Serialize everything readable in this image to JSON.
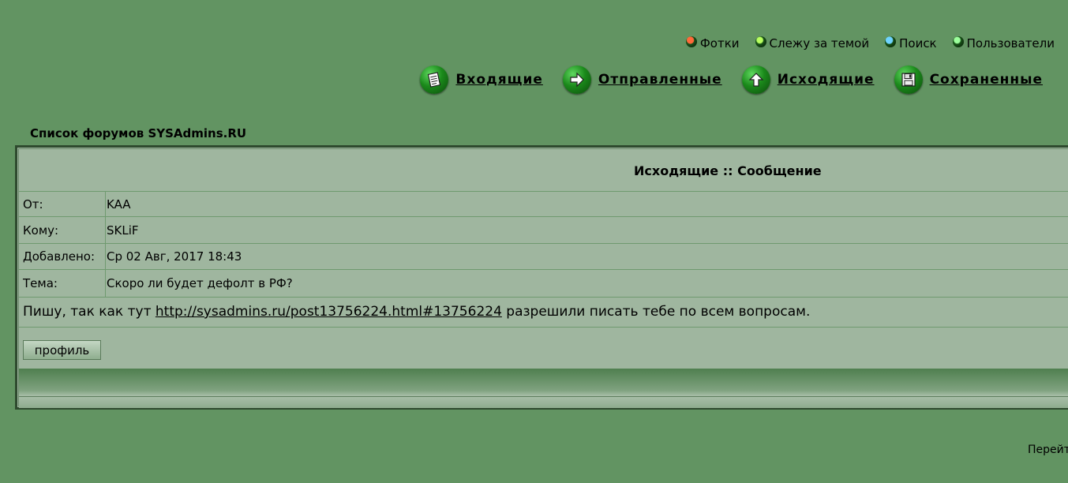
{
  "top_links": [
    {
      "label": "Фотки",
      "icon": "red-dot-icon"
    },
    {
      "label": "Слежу за темой",
      "icon": "green-dot-icon"
    },
    {
      "label": "Поиск",
      "icon": "blue-dot-icon"
    },
    {
      "label": "Пользователи",
      "icon": "list-dot-icon"
    }
  ],
  "nav": [
    {
      "label": "Входящие",
      "icon": "inbox-icon"
    },
    {
      "label": "Отправленные",
      "icon": "arrow-right-icon"
    },
    {
      "label": "Исходящие",
      "icon": "arrow-up-icon"
    },
    {
      "label": "Сохраненные",
      "icon": "floppy-disk-icon"
    }
  ],
  "forum_link": "Список форумов SYSAdmins.RU",
  "message": {
    "header": "Исходящие :: Сообщение",
    "from_label": "От:",
    "from": "KAA",
    "to_label": "Кому:",
    "to": "SKLiF",
    "added_label": "Добавлено:",
    "added": "Ср 02 Авг, 2017 18:43",
    "subject_label": "Тема:",
    "subject": "Скоро ли будет дефолт в РФ?",
    "body_before": "Пишу, так как тут ",
    "body_link": "http://sysadmins.ru/post13756224.html#13756224",
    "body_after": " разрешили писать тебе по всем вопросам.",
    "profile_button": "профиль"
  },
  "goto_label": "Перейт"
}
